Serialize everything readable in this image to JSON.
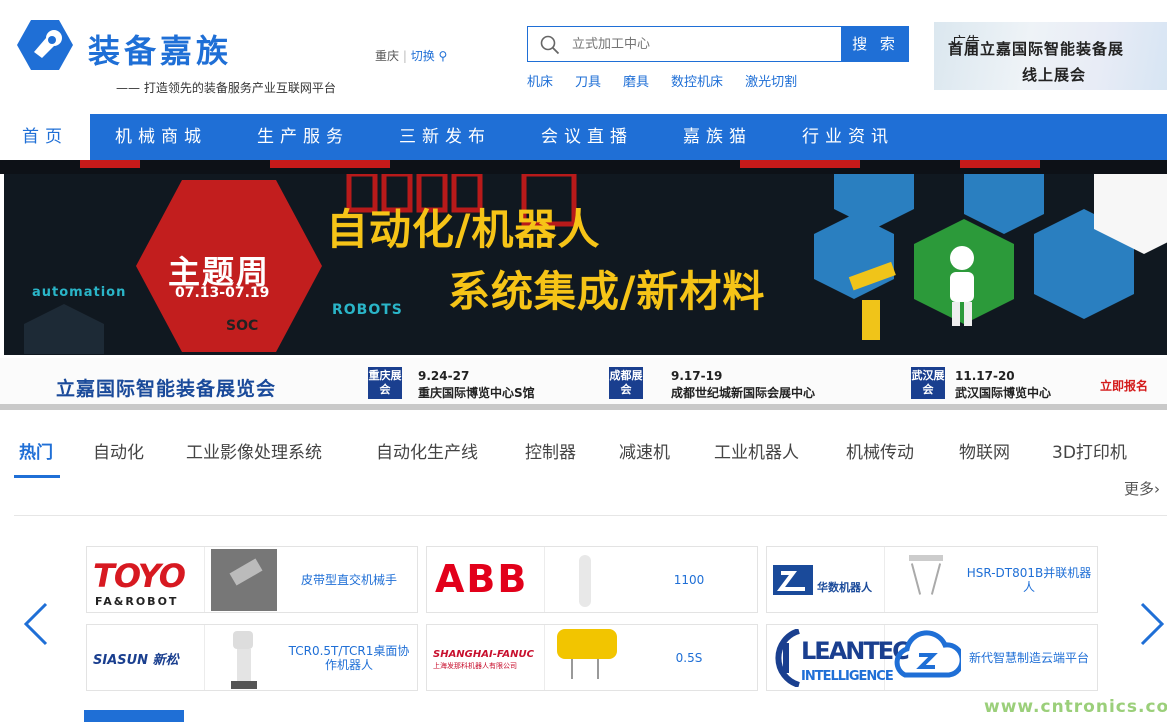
{
  "header": {
    "brand": "装备嘉族",
    "slogan": "—— 打造领先的装备服务产业互联网平台",
    "city": "重庆",
    "switch_label": "切换"
  },
  "search": {
    "placeholder": "立式加工中心",
    "button": "搜 索",
    "hotwords": [
      "机床",
      "刀具",
      "磨具",
      "数控机床",
      "激光切割"
    ]
  },
  "ad": {
    "tag": "广告",
    "line1": "首届立嘉国际智能装备展",
    "line2": "线上展会"
  },
  "nav": {
    "home": "首页",
    "items": [
      "机械商城",
      "生产服务",
      "三新发布",
      "会议直播",
      "嘉族猫",
      "行业资讯"
    ]
  },
  "banner": {
    "theme_title": "主题周",
    "theme_date": "07.13-07.19",
    "headline1": "自动化/机器人",
    "headline2": "系统集成/新材料",
    "tag_automation": "automation",
    "tag_robots": "ROBOTS",
    "tag_soc": "SOC"
  },
  "expo": {
    "logo": "立嘉国际智能装备展览会",
    "signup": "立即报名",
    "sessions": [
      {
        "badge": "重庆展会",
        "date": "9.24-27",
        "venue": "重庆国际博览中心S馆"
      },
      {
        "badge": "成都展会",
        "date": "9.17-19",
        "venue": "成都世纪城新国际会展中心"
      },
      {
        "badge": "武汉展会",
        "date": "11.17-20",
        "venue": "武汉国际博览中心"
      }
    ]
  },
  "tabs": {
    "items": [
      "热门",
      "自动化",
      "工业影像处理系统",
      "自动化生产线",
      "控制器",
      "减速机",
      "工业机器人",
      "机械传动",
      "物联网",
      "3D打印机"
    ],
    "more": "更多›"
  },
  "products": [
    {
      "brand": "TOYO",
      "brand_sub": "FA&ROBOT",
      "name": "皮带型直交机械手"
    },
    {
      "brand": "ABB",
      "brand_sub": "",
      "name": "1100"
    },
    {
      "brand": "华数机器人",
      "brand_sub": "",
      "name": "HSR-DT801B并联机器人"
    },
    {
      "brand": "SIASUN 新松",
      "brand_sub": "",
      "name": "TCR0.5T/TCR1桌面协作机器人"
    },
    {
      "brand": "SHANGHAI-FANUC",
      "brand_sub": "上海发那科机器人有限公司",
      "name": "0.5S"
    },
    {
      "brand": "LEANTEC",
      "brand_sub": "INTELLIGENCE",
      "name": "新代智慧制造云端平台"
    }
  ],
  "watermark": "www.cntronics.com",
  "colors": {
    "primary": "#1f6fd6",
    "banner_yellow": "#f6c417",
    "banner_red": "#c61a1a"
  }
}
